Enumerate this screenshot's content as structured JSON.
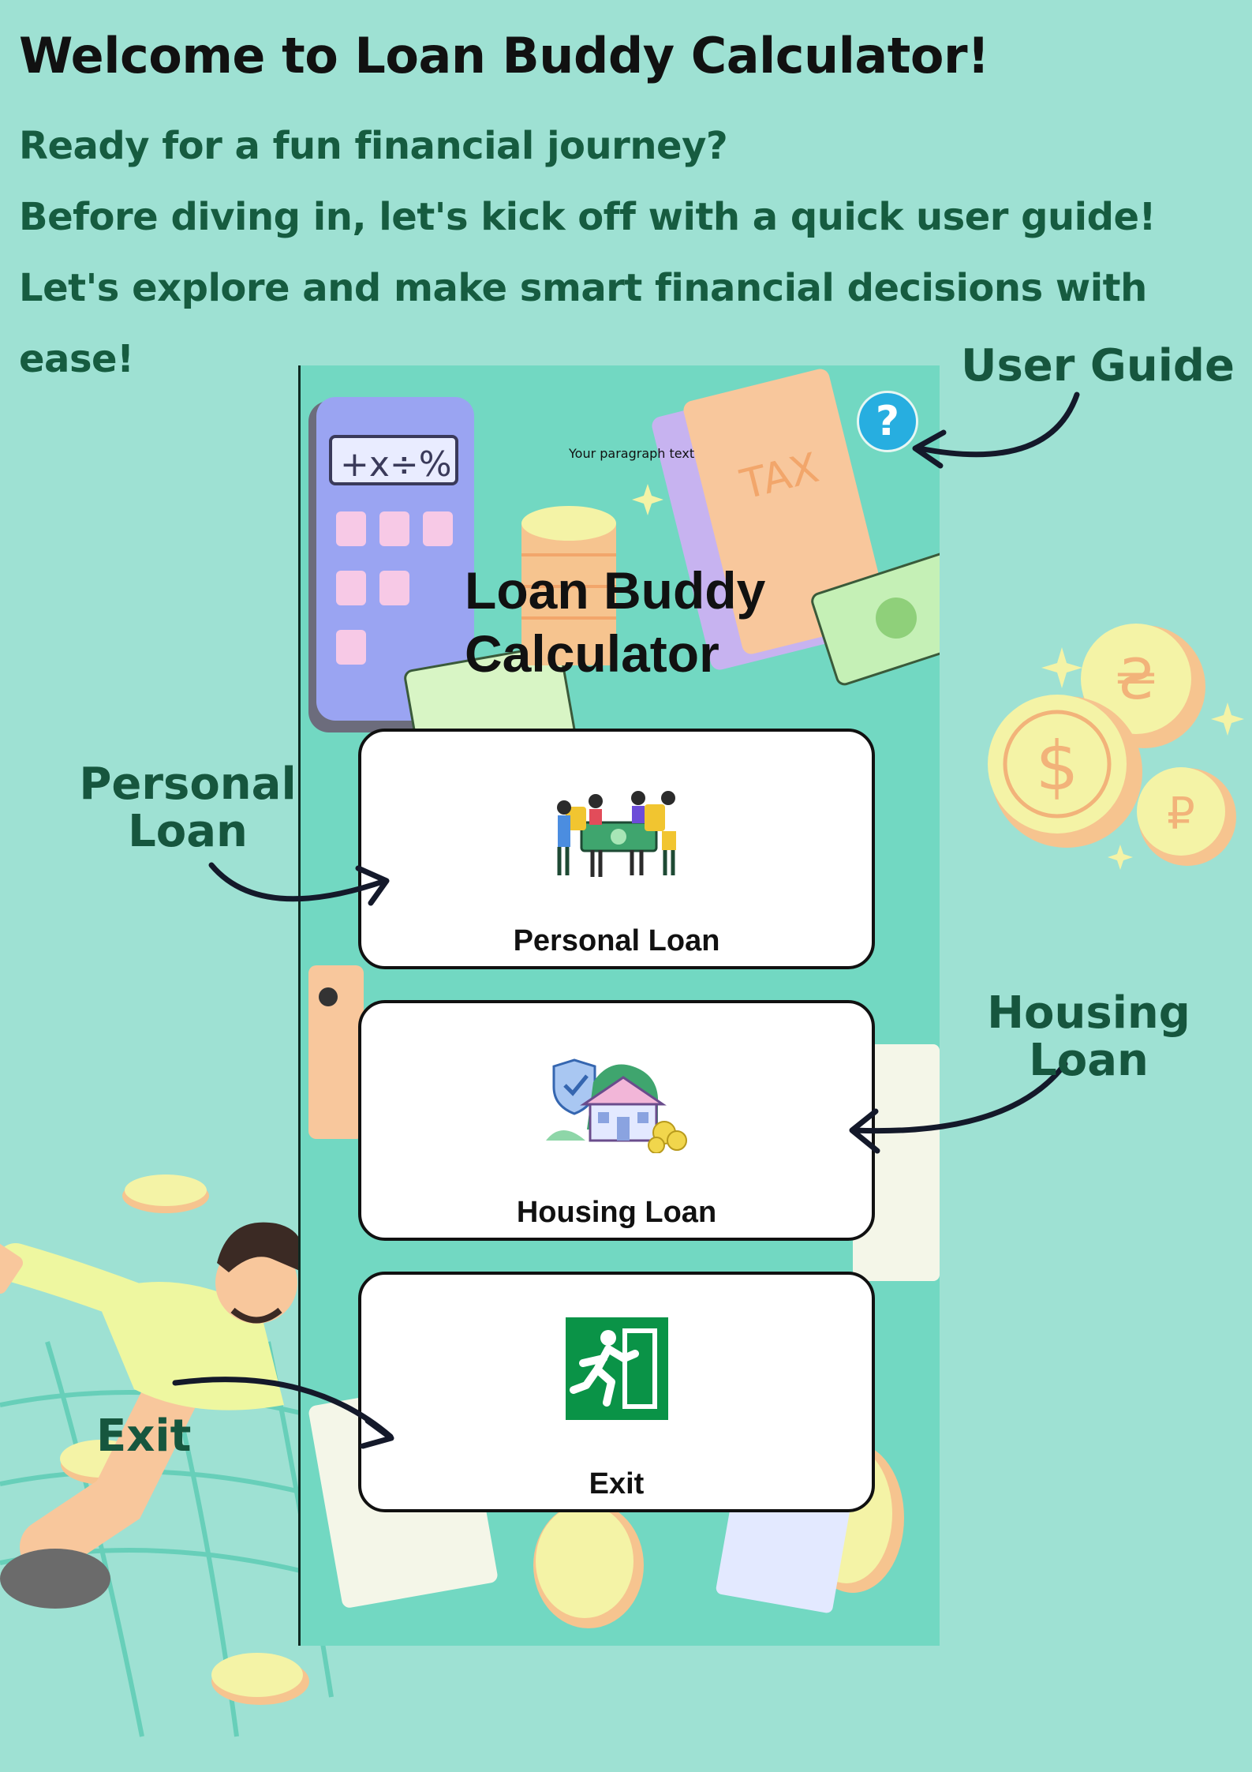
{
  "guide": {
    "headline": "Welcome to Loan Buddy Calculator!",
    "intro_lines": [
      "Ready for a fun financial journey?",
      "Before diving in, let's kick off with a quick user guide!",
      "Let's explore and make smart financial decisions with ease!"
    ],
    "callouts": {
      "user_guide": "User Guide",
      "personal_loan": "Personal Loan",
      "housing_loan": "Housing Loan",
      "exit": "Exit"
    }
  },
  "app": {
    "title": "Loan Buddy Calculator",
    "paragraph_placeholder": "Your paragraph text",
    "help_glyph": "?",
    "menu": [
      {
        "label": "Personal Loan",
        "icon": "people-holding-money-icon"
      },
      {
        "label": "Housing Loan",
        "icon": "insured-house-icon"
      },
      {
        "label": "Exit",
        "icon": "emergency-exit-icon"
      }
    ]
  },
  "colors": {
    "page_background": "#9ee1d3",
    "phone_background": "#72d8c2",
    "intro_text": "#165c40",
    "callout_text": "#16563e",
    "help_button": "#27aee0",
    "exit_sign": "#0a9347"
  }
}
